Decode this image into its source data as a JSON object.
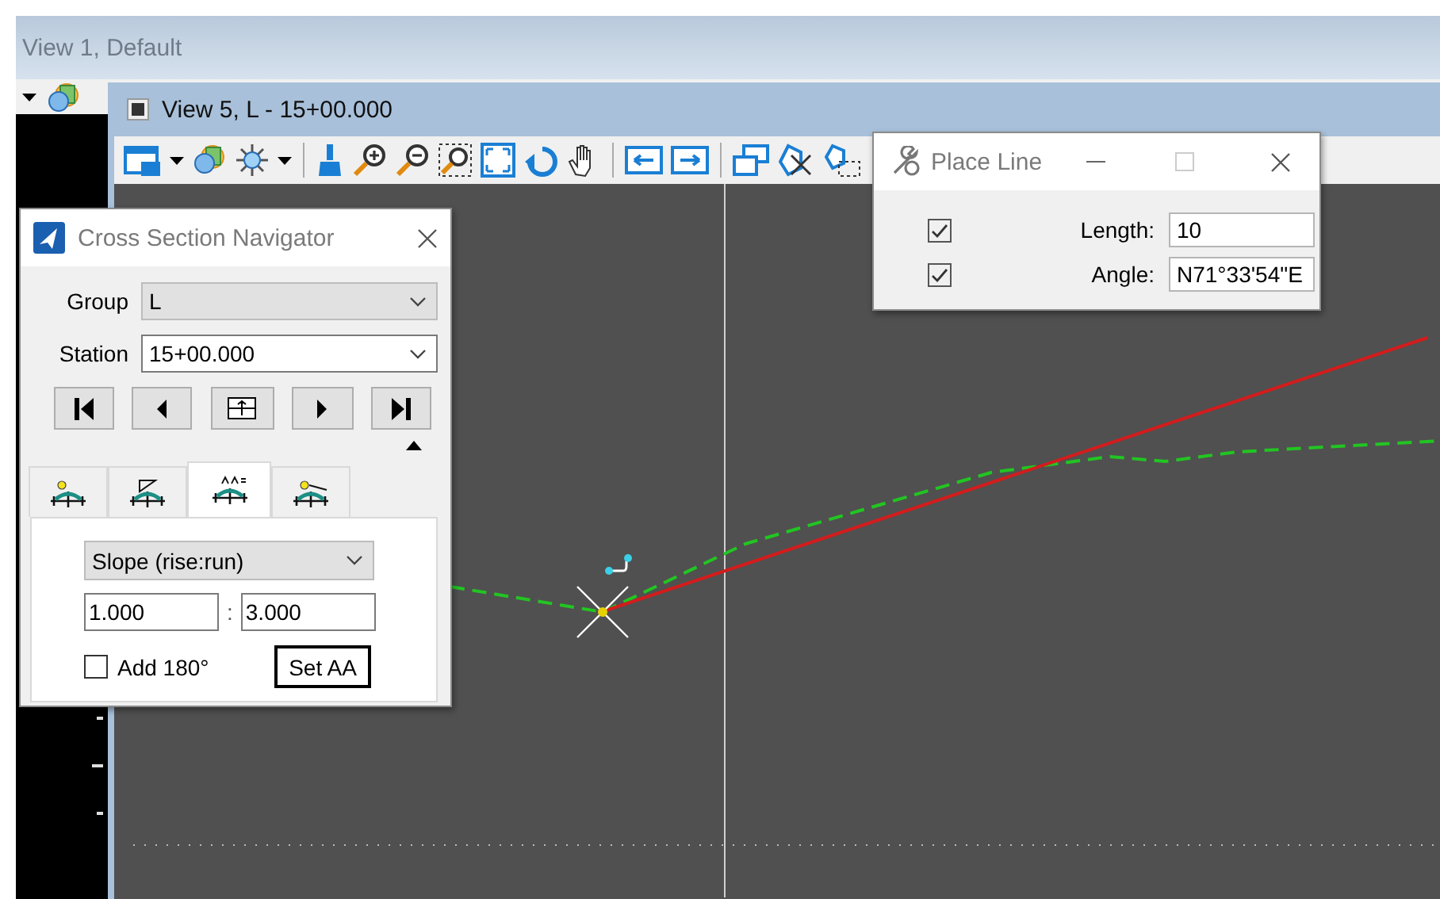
{
  "view1": {
    "title": "View 1, Default"
  },
  "view5": {
    "title": "View 5, L - 15+00.000"
  },
  "navigator": {
    "title": "Cross Section Navigator",
    "group": {
      "label": "Group",
      "value": "L"
    },
    "station": {
      "label": "Station",
      "value": "15+00.000"
    },
    "tabs": [
      {
        "selected": false
      },
      {
        "selected": false
      },
      {
        "selected": true
      },
      {
        "selected": false
      }
    ],
    "method": {
      "value": "Slope (rise:run)"
    },
    "rise": "1.000",
    "separator": ":",
    "run": "3.000",
    "add180": {
      "label": "Add 180°",
      "checked": false
    },
    "set_button": "Set AA"
  },
  "place_line": {
    "title": "Place Line",
    "fields": [
      {
        "label": "Length:",
        "checked": true,
        "value": "10"
      },
      {
        "label": "Angle:",
        "checked": true,
        "value": "N71°33'54\"E"
      }
    ]
  }
}
